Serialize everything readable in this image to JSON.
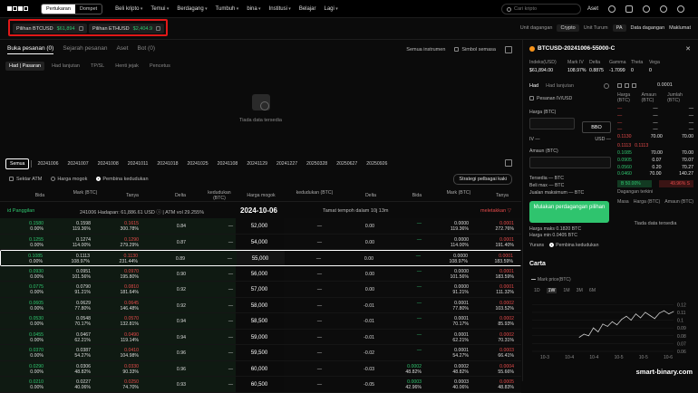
{
  "nav": {
    "segment": [
      "Pertukaran",
      "Dompet"
    ],
    "items": [
      "Beli kripto",
      "Temui",
      "Berdagang",
      "Tumbuh",
      "bina",
      "Institusi",
      "Belajar",
      "Lagi"
    ],
    "search_placeholder": "Cari kripto",
    "asset_label": "Aset"
  },
  "subbar": {
    "btc_label": "Pilihan BTCUSD",
    "btc_price": "$61,894",
    "eth_label": "Pilihan ETHUSD",
    "eth_price": "$2,404.9",
    "unit_label": "Unit dagangan",
    "unit_value": "Crypto",
    "unit2_label": "Unit Turum",
    "unit2_value": "PA",
    "data_label": "Data dagangan",
    "info_label": "Maklumat"
  },
  "tabs": [
    "Buka pesanan (0)",
    "Sejarah pesanan",
    "Aset",
    "Bot (0)"
  ],
  "filters": {
    "instrument": "Semua instrumen",
    "symbol": "Simbol semasa"
  },
  "order_tabs": [
    "Had | Pasaran",
    "Had lanjutan",
    "TP/SL",
    "Henti jejak",
    "Pencetus"
  ],
  "empty_text": "Tiada data tersedia",
  "dates": [
    "Semua",
    "20241006",
    "20241007",
    "20241008",
    "20241011",
    "20241018",
    "20241025",
    "20241108",
    "20241129",
    "20241227",
    "20250328",
    "20250627",
    "20250926"
  ],
  "options": {
    "atm": "Sektar ATM",
    "greeks": "Harga mogok",
    "builder": "Pembina kedudukan",
    "strategy": "Strategi pelbagai kaki"
  },
  "headers": {
    "bid": "Bida",
    "mark": "Mark (BTC)",
    "ask": "Tanya",
    "delta": "Delta",
    "position": "kedudukan (BTC)",
    "strike": "Harga mogok",
    "rposition": "kedudukan (BTC)",
    "rdelta": "Delta",
    "rbid": "Bida",
    "rmark": "Mark (BTC)",
    "rask": "Tanya"
  },
  "expiry": {
    "calls_label": "id Panggilan",
    "info": "241006 Hadapan: 61,886.61 USD  ⓘ  |  ATM vol 29.255%",
    "date": "2024-10-06",
    "time_left": "Tamat tempoh dalam 10j 13m",
    "puts_label": "meletakkan ▽"
  },
  "rows": [
    {
      "bid": "0.1580",
      "bid_iv": "0.00%",
      "mark": "0.1598",
      "mark_iv": "119.36%",
      "ask": "0.1615",
      "ask_iv": "300.78%",
      "delta": "0.84",
      "pos": "—",
      "strike": "52,000",
      "rpos": "—",
      "rdelta": "0.00",
      "rbid": "—",
      "rmark": "0.0000",
      "rmark_iv": "119.36%",
      "rask": "0.0001",
      "rask_iv": "272.76%"
    },
    {
      "bid": "0.1255",
      "bid_iv": "0.00%",
      "mark": "0.1274",
      "mark_iv": "114.00%",
      "ask": "0.1290",
      "ask_iv": "279.29%",
      "delta": "0.87",
      "pos": "—",
      "strike": "54,000",
      "rpos": "—",
      "rdelta": "0.00",
      "rbid": "—",
      "rmark": "0.0000",
      "rmark_iv": "114.00%",
      "rask": "0.0001",
      "rask_iv": "191.40%"
    },
    {
      "bid": "0.1085",
      "bid_iv": "0.00%",
      "mark": "0.1113",
      "mark_iv": "108.97%",
      "ask": "0.1130",
      "ask_iv": "231.44%",
      "delta": "0.89",
      "pos": "—",
      "strike": "55,000",
      "rpos": "—",
      "rdelta": "0.00",
      "rbid": "—",
      "rmark": "0.0000",
      "rmark_iv": "108.97%",
      "rask": "0.0001",
      "rask_iv": "183.59%"
    },
    {
      "bid": "0.0930",
      "bid_iv": "0.00%",
      "mark": "0.0951",
      "mark_iv": "101.56%",
      "ask": "0.0970",
      "ask_iv": "195.80%",
      "delta": "0.90",
      "pos": "—",
      "strike": "56,000",
      "rpos": "—",
      "rdelta": "0.00",
      "rbid": "—",
      "rmark": "0.0000",
      "rmark_iv": "101.56%",
      "rask": "0.0001",
      "rask_iv": "183.59%"
    },
    {
      "bid": "0.0775",
      "bid_iv": "0.00%",
      "mark": "0.0790",
      "mark_iv": "91.21%",
      "ask": "0.0810",
      "ask_iv": "181.64%",
      "delta": "0.92",
      "pos": "—",
      "strike": "57,000",
      "rpos": "—",
      "rdelta": "0.00",
      "rbid": "—",
      "rmark": "0.0000",
      "rmark_iv": "91.21%",
      "rask": "0.0001",
      "rask_iv": "111.32%"
    },
    {
      "bid": "0.0605",
      "bid_iv": "0.00%",
      "mark": "0.0629",
      "mark_iv": "77.80%",
      "ask": "0.0645",
      "ask_iv": "146.48%",
      "delta": "0.92",
      "pos": "—",
      "strike": "58,000",
      "rpos": "—",
      "rdelta": "-0.01",
      "rbid": "—",
      "rmark": "0.0001",
      "rmark_iv": "77.80%",
      "rask": "0.0002",
      "rask_iv": "103.52%"
    },
    {
      "bid": "0.0530",
      "bid_iv": "0.00%",
      "mark": "0.0548",
      "mark_iv": "70.17%",
      "ask": "0.0570",
      "ask_iv": "132.81%",
      "delta": "0.94",
      "pos": "—",
      "strike": "58,500",
      "rpos": "—",
      "rdelta": "-0.01",
      "rbid": "—",
      "rmark": "0.0001",
      "rmark_iv": "70.17%",
      "rask": "0.0002",
      "rask_iv": "85.93%"
    },
    {
      "bid": "0.0455",
      "bid_iv": "0.00%",
      "mark": "0.0467",
      "mark_iv": "62.21%",
      "ask": "0.0490",
      "ask_iv": "119.14%",
      "delta": "0.94",
      "pos": "—",
      "strike": "59,000",
      "rpos": "—",
      "rdelta": "-0.01",
      "rbid": "—",
      "rmark": "0.0001",
      "rmark_iv": "62.21%",
      "rask": "0.0002",
      "rask_iv": "70.31%"
    },
    {
      "bid": "0.0370",
      "bid_iv": "0.00%",
      "mark": "0.0387",
      "mark_iv": "54.27%",
      "ask": "0.0410",
      "ask_iv": "104.98%",
      "delta": "0.96",
      "pos": "—",
      "strike": "59,500",
      "rpos": "—",
      "rdelta": "-0.02",
      "rbid": "—",
      "rmark": "0.0001",
      "rmark_iv": "54.27%",
      "rask": "0.0003",
      "rask_iv": "66.41%"
    },
    {
      "bid": "0.0290",
      "bid_iv": "0.00%",
      "mark": "0.0306",
      "mark_iv": "48.82%",
      "ask": "0.0330",
      "ask_iv": "90.33%",
      "delta": "0.96",
      "pos": "—",
      "strike": "60,000",
      "rpos": "—",
      "rdelta": "-0.03",
      "rbid": "0.0002",
      "rbid_iv": "48.82%",
      "rmark": "0.0002",
      "rmark_iv": "48.82%",
      "rask": "0.0004",
      "rask_iv": "55.66%"
    },
    {
      "bid": "0.0210",
      "bid_iv": "0.00%",
      "mark": "0.0227",
      "mark_iv": "40.06%",
      "ask": "0.0250",
      "ask_iv": "74.70%",
      "delta": "0.93",
      "pos": "—",
      "strike": "60,500",
      "rpos": "—",
      "rdelta": "-0.05",
      "rbid": "0.0003",
      "rbid_iv": "42.96%",
      "rmark": "0.0003",
      "rmark_iv": "40.06%",
      "rask": "0.0005",
      "rask_iv": "48.83%"
    }
  ],
  "right": {
    "title": "BTCUSD-20241006-55000-C",
    "stats": [
      {
        "k": "Indeks(USD)",
        "v": "$61,894.00"
      },
      {
        "k": "Mark IV",
        "v": "108.97%"
      },
      {
        "k": "Delta",
        "v": "0.8875"
      },
      {
        "k": "Gamma",
        "v": "-1.7099"
      },
      {
        "k": "Theta",
        "v": "0"
      },
      {
        "k": "Vega",
        "v": "0"
      }
    ],
    "ltabs": [
      "Had",
      "Had lanjutan"
    ],
    "iv_check": "Pesanan IV/USD",
    "price_label": "Harga (BTC)",
    "bbo": "BBO",
    "iv_label": "IV —",
    "usd_label": "USD —",
    "amount_label": "Amaun (BTC)",
    "avail": [
      "Tersedia — BTC",
      "Beli max — BTC",
      "Jualan maksimum — BTC"
    ],
    "button": "Mulakan perdagangan pilihan",
    "fee": [
      "Harga maks 0.1820 BTC",
      "Harga min 0.0405 BTC"
    ],
    "yield_label": "Yurans",
    "builder_label": "Pembina kedudukan",
    "ob_step": "0.0001",
    "ob_headers": [
      "Harga (BTC)",
      "Amaun (BTC)",
      "Jumlah (BTC)"
    ],
    "asks": [
      [
        "—",
        "—",
        "—"
      ],
      [
        "—",
        "—",
        "—"
      ],
      [
        "—",
        "—",
        "—"
      ],
      [
        "—",
        "—",
        "—"
      ],
      [
        "0.1130",
        "70.00",
        "70.00"
      ]
    ],
    "mid": [
      "0.1113",
      "0.1113"
    ],
    "bids": [
      [
        "0.1085",
        "70.00",
        "70.00"
      ],
      [
        "0.0905",
        "0.07",
        "70.07"
      ],
      [
        "0.0560",
        "0.20",
        "70.27"
      ],
      [
        "0.0460",
        "70.00",
        "140.27"
      ]
    ],
    "pct_buy": "B 50.00%",
    "pct_sell": "49.96% S",
    "trades_label": "Dagangan terkini",
    "trades_cols": [
      "Masa",
      "Harga (BTC)",
      "Amaun (BTC)"
    ],
    "trades_empty": "Tiada data tersedia",
    "chart_title": "Carta",
    "legend": "Mark price(BTC)",
    "periods": [
      "1D",
      "1W",
      "1M",
      "3M",
      "6M"
    ]
  },
  "chart_data": {
    "type": "line",
    "x": [
      "10-3",
      "10-4",
      "10-4",
      "10-5",
      "10-5",
      "10-6"
    ],
    "values": [
      0.078,
      0.082,
      0.08,
      0.09,
      0.085,
      0.095,
      0.092,
      0.098,
      0.094,
      0.101,
      0.105,
      0.1,
      0.108,
      0.103,
      0.11,
      0.106,
      0.102,
      0.109,
      0.112,
      0.108,
      0.111
    ],
    "yticks": [
      "0.12",
      "0.11",
      "0.1",
      "0.09",
      "0.08",
      "0.07",
      "0.06"
    ],
    "ylim": [
      0.06,
      0.125
    ],
    "xlabel": "",
    "ylabel": ""
  },
  "watermark": "smart-binary.com"
}
